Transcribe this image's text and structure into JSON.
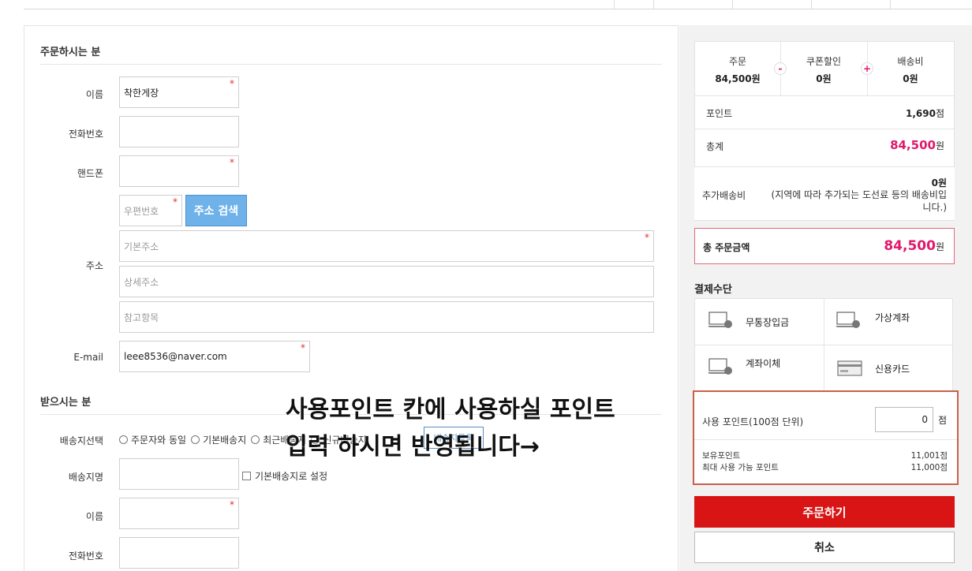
{
  "orderer": {
    "title": "주문하시는 분",
    "name_label": "이름",
    "name_value": "착한게장",
    "phone_label": "전화번호",
    "phone_value": "",
    "mobile_label": "핸드폰",
    "mobile_value": "",
    "address_label": "주소",
    "zipcode_placeholder": "우편번호",
    "address_search_button": "주소 검색",
    "base_address_placeholder": "기본주소",
    "detail_address_placeholder": "상세주소",
    "reference_placeholder": "참고항목",
    "email_label": "E-mail",
    "email_value": "leee8536@naver.com",
    "required_mark": "*"
  },
  "receiver": {
    "title": "받으시는 분",
    "select_label": "배송지선택",
    "options": [
      "주문자와 동일",
      "기본배송지",
      "최근배송지",
      "신규배송지"
    ],
    "addressbook_button": "배송지목록",
    "place_name_label": "배송지명",
    "default_checkbox_label": "기본배송지로 설정",
    "name_label": "이름",
    "phone_label": "전화번호"
  },
  "overlay": {
    "line1": "사용포인트 칸에 사용하실 포인트",
    "line2": "입력 하시면 반영됩니다→"
  },
  "summary": {
    "order_label": "주문",
    "order_value": "84,500원",
    "coupon_label": "쿠폰할인",
    "coupon_value": "0원",
    "shipping_label": "배송비",
    "shipping_value": "0원",
    "minus_sign": "-",
    "plus_sign": "+",
    "point_label": "포인트",
    "point_value": "1,690",
    "point_unit": "점",
    "subtotal_label": "총계",
    "subtotal_value": "84,500",
    "won": "원",
    "extra_label": "추가배송비",
    "extra_value": "0원",
    "extra_note": "(지역에 따라 추가되는 도선료 등의 배송비입니다.)",
    "total_label": "총 주문금액",
    "total_value": "84,500"
  },
  "payment": {
    "title": "결제수단",
    "methods": [
      "무통장입금",
      "가상계좌",
      "계좌이체",
      "신용카드"
    ]
  },
  "points": {
    "use_label": "사용 포인트(100점 단위)",
    "use_value": "0",
    "unit": "점",
    "owned_label": "보유포인트",
    "owned_value": "11,001점",
    "max_label": "최대 사용 가능 포인트",
    "max_value": "11,000점"
  },
  "actions": {
    "order_button": "주문하기",
    "cancel_button": "취소"
  },
  "colors": {
    "accent_pink": "#e0196b",
    "order_red": "#d81414",
    "search_blue": "#6fb2ea"
  }
}
